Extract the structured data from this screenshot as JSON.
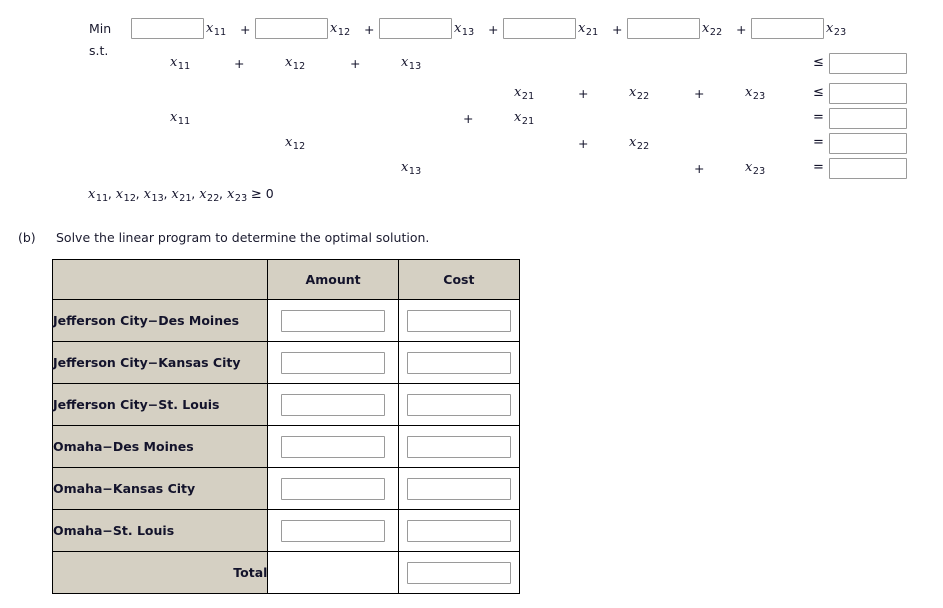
{
  "objective": {
    "min_label": "Min",
    "st_label": "s.t.",
    "terms": [
      {
        "input_value": "",
        "placeholder": "",
        "variable": "x",
        "subscript": "11",
        "operator_after": "+"
      },
      {
        "input_value": "",
        "placeholder": "",
        "variable": "x",
        "subscript": "12",
        "operator_after": "+"
      },
      {
        "input_value": "",
        "placeholder": "",
        "variable": "x",
        "subscript": "13",
        "operator_after": "+"
      },
      {
        "input_value": "",
        "placeholder": "",
        "variable": "x",
        "subscript": "21",
        "operator_after": "+"
      },
      {
        "input_value": "",
        "placeholder": "",
        "variable": "x",
        "subscript": "22",
        "operator_after": "+"
      },
      {
        "input_value": "",
        "placeholder": "",
        "variable": "x",
        "subscript": "23",
        "operator_after": ""
      }
    ]
  },
  "constraints": {
    "column_variables": [
      "x11",
      "x12",
      "x13",
      "x21",
      "x22",
      "x23"
    ],
    "rows": [
      {
        "cells": [
          {
            "op": "",
            "var": "x",
            "sub": "11"
          },
          {
            "op": "+",
            "var": "x",
            "sub": "12"
          },
          {
            "op": "+",
            "var": "x",
            "sub": "13"
          },
          {
            "op": "",
            "var": "",
            "sub": ""
          },
          {
            "op": "",
            "var": "",
            "sub": ""
          },
          {
            "op": "",
            "var": "",
            "sub": ""
          }
        ],
        "relation": "≤",
        "rhs_value": "",
        "rhs_placeholder": ""
      },
      {
        "cells": [
          {
            "op": "",
            "var": "",
            "sub": ""
          },
          {
            "op": "",
            "var": "",
            "sub": ""
          },
          {
            "op": "",
            "var": "",
            "sub": ""
          },
          {
            "op": "",
            "var": "x",
            "sub": "21"
          },
          {
            "op": "+",
            "var": "x",
            "sub": "22"
          },
          {
            "op": "+",
            "var": "x",
            "sub": "23"
          }
        ],
        "relation": "≤",
        "rhs_value": "",
        "rhs_placeholder": ""
      },
      {
        "cells": [
          {
            "op": "",
            "var": "x",
            "sub": "11"
          },
          {
            "op": "",
            "var": "",
            "sub": ""
          },
          {
            "op": "",
            "var": "",
            "sub": ""
          },
          {
            "op": "+",
            "var": "x",
            "sub": "21"
          },
          {
            "op": "",
            "var": "",
            "sub": ""
          },
          {
            "op": "",
            "var": "",
            "sub": ""
          }
        ],
        "relation": "=",
        "rhs_value": "",
        "rhs_placeholder": ""
      },
      {
        "cells": [
          {
            "op": "",
            "var": "",
            "sub": ""
          },
          {
            "op": "",
            "var": "x",
            "sub": "12"
          },
          {
            "op": "",
            "var": "",
            "sub": ""
          },
          {
            "op": "",
            "var": "",
            "sub": ""
          },
          {
            "op": "+",
            "var": "x",
            "sub": "22"
          },
          {
            "op": "",
            "var": "",
            "sub": ""
          }
        ],
        "relation": "=",
        "rhs_value": "",
        "rhs_placeholder": ""
      },
      {
        "cells": [
          {
            "op": "",
            "var": "",
            "sub": ""
          },
          {
            "op": "",
            "var": "",
            "sub": ""
          },
          {
            "op": "",
            "var": "x",
            "sub": "13"
          },
          {
            "op": "",
            "var": "",
            "sub": ""
          },
          {
            "op": "",
            "var": "",
            "sub": ""
          },
          {
            "op": "+",
            "var": "x",
            "sub": "23"
          }
        ],
        "relation": "=",
        "rhs_value": "",
        "rhs_placeholder": ""
      }
    ]
  },
  "nonnegativity": {
    "variables": [
      "x11",
      "x12",
      "x13",
      "x21",
      "x22",
      "x23"
    ],
    "relation": "≥",
    "bound": "0"
  },
  "part_b": {
    "label": "(b)",
    "text": "Solve the linear program to determine the optimal solution."
  },
  "table": {
    "headers": [
      "",
      "Amount",
      "Cost"
    ],
    "rows": [
      {
        "label": "Jefferson City−Des Moines",
        "amount": "",
        "cost": "",
        "amount_input": true,
        "cost_input": true
      },
      {
        "label": "Jefferson City−Kansas City",
        "amount": "",
        "cost": "",
        "amount_input": true,
        "cost_input": true
      },
      {
        "label": "Jefferson City−St. Louis",
        "amount": "",
        "cost": "",
        "amount_input": true,
        "cost_input": true
      },
      {
        "label": "Omaha−Des Moines",
        "amount": "",
        "cost": "",
        "amount_input": true,
        "cost_input": true
      },
      {
        "label": "Omaha−Kansas City",
        "amount": "",
        "cost": "",
        "amount_input": true,
        "cost_input": true
      },
      {
        "label": "Omaha−St. Louis",
        "amount": "",
        "cost": "",
        "amount_input": true,
        "cost_input": true
      },
      {
        "label": "Total",
        "amount": "",
        "cost": "",
        "amount_input": false,
        "cost_input": true
      }
    ]
  },
  "colors": {
    "header_bg": "#d5d0c3",
    "row_label_bg": "#d5d0c3",
    "cell_bg": "#ffffff",
    "border": "#000000",
    "text": "#13132b",
    "input_border": "#9a9a9a",
    "page_bg": "#ffffff"
  }
}
